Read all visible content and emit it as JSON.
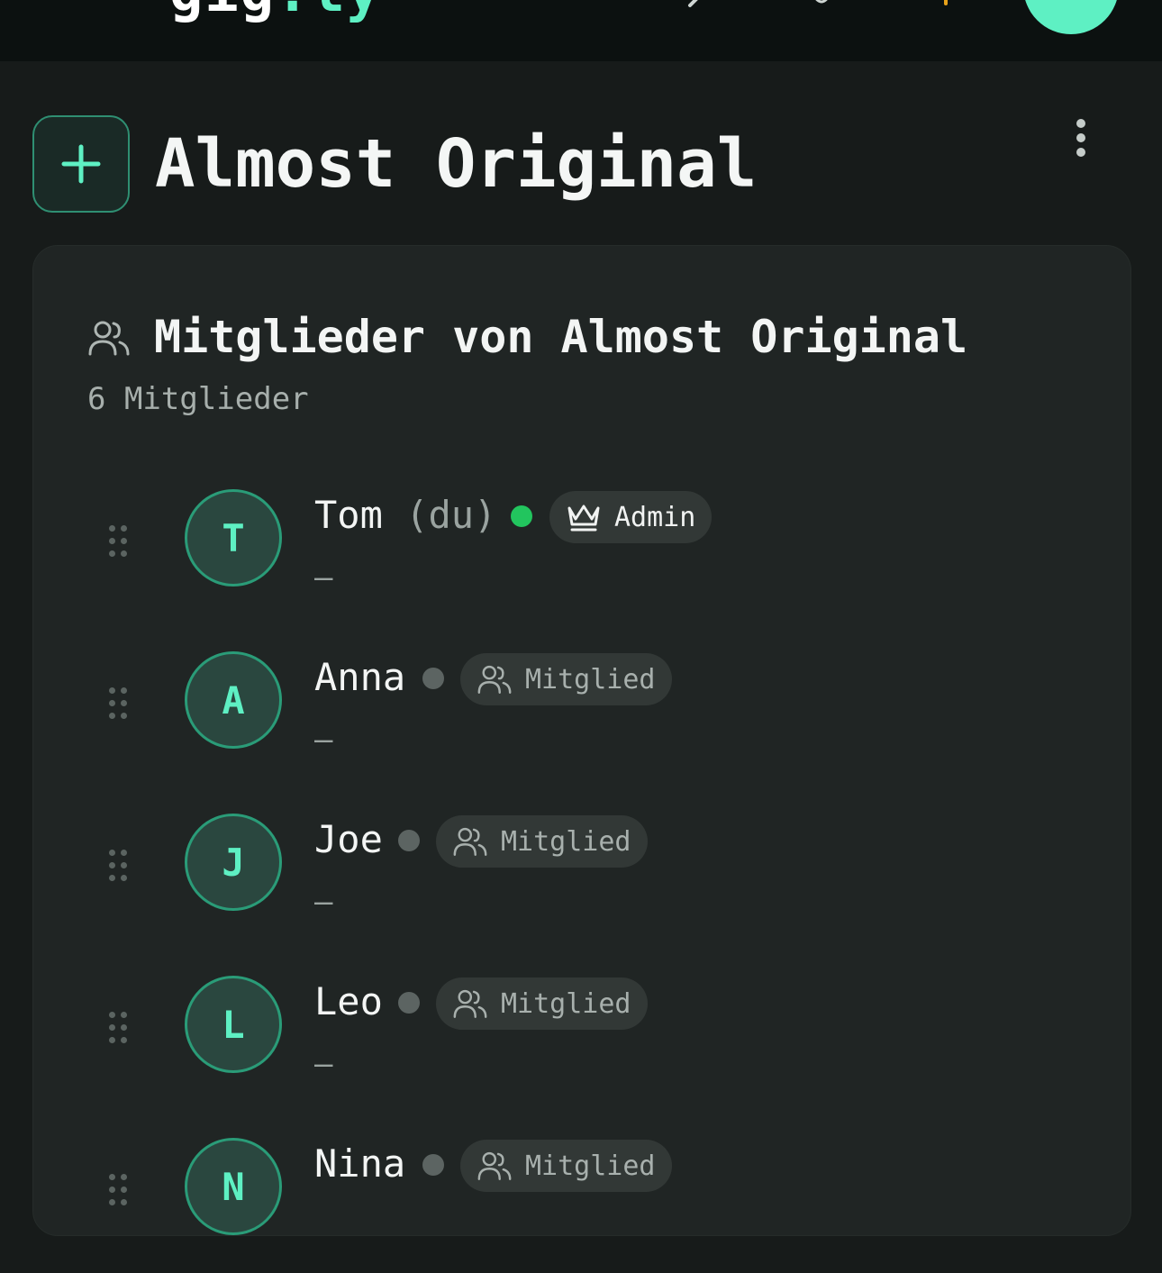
{
  "header": {
    "logo_main": "gig",
    "logo_accent": ".ly"
  },
  "page": {
    "title": "Almost Original"
  },
  "members_card": {
    "title": "Mitglieder von Almost Original",
    "count_label": "6 Mitglieder",
    "members": [
      {
        "initial": "T",
        "name": "Tom",
        "you_label": "(du)",
        "online": true,
        "role": "Admin",
        "role_icon": "crown-icon",
        "description": "–"
      },
      {
        "initial": "A",
        "name": "Anna",
        "online": false,
        "role": "Mitglied",
        "role_icon": "users-icon",
        "description": "–"
      },
      {
        "initial": "J",
        "name": "Joe",
        "online": false,
        "role": "Mitglied",
        "role_icon": "users-icon",
        "description": "–"
      },
      {
        "initial": "L",
        "name": "Leo",
        "online": false,
        "role": "Mitglied",
        "role_icon": "users-icon",
        "description": "–"
      },
      {
        "initial": "N",
        "name": "Nina",
        "online": false,
        "role": "Mitglied",
        "role_icon": "users-icon",
        "description": "–"
      }
    ]
  },
  "colors": {
    "accent": "#5ef0c3",
    "online": "#22c55e",
    "offline": "#5c6462",
    "background": "#171b1a",
    "card": "#202524"
  }
}
